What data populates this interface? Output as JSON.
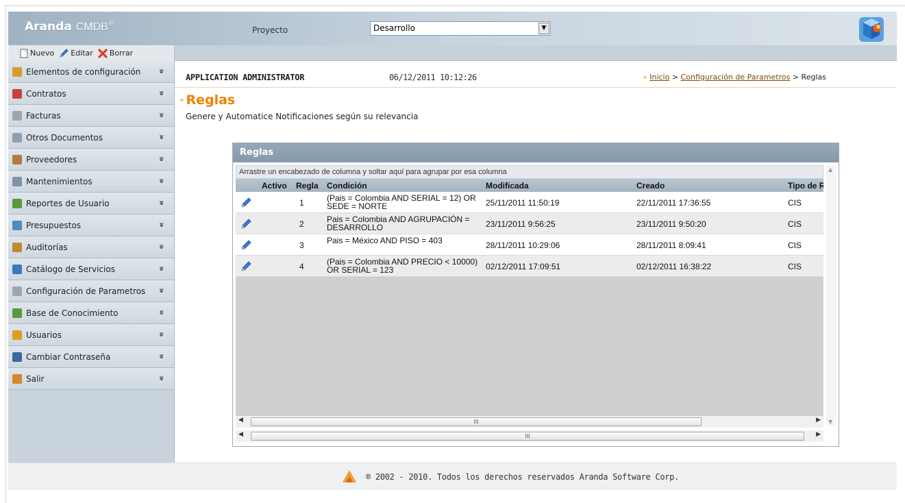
{
  "header": {
    "logo_brand": "Aranda",
    "logo_product": "CMDB",
    "logo_reg": "®",
    "project_label": "Proyecto",
    "project_value": "Desarrollo"
  },
  "toolbar": {
    "new_label": "Nuevo",
    "edit_label": "Editar",
    "delete_label": "Borrar"
  },
  "sidebar": {
    "items": [
      {
        "label": "Elementos de configuración",
        "icon": "gear-icon",
        "color": "#d89b2a"
      },
      {
        "label": "Contratos",
        "icon": "contract-icon",
        "color": "#c84040"
      },
      {
        "label": "Facturas",
        "icon": "invoice-icon",
        "color": "#9aa7b3"
      },
      {
        "label": "Otros Documentos",
        "icon": "documents-icon",
        "color": "#8fa0b0"
      },
      {
        "label": "Proveedores",
        "icon": "provider-icon",
        "color": "#b07a40"
      },
      {
        "label": "Mantenimientos",
        "icon": "maintenance-icon",
        "color": "#7f93a6"
      },
      {
        "label": "Reportes de Usuario",
        "icon": "report-icon",
        "color": "#5a9a3a"
      },
      {
        "label": "Presupuestos",
        "icon": "budget-icon",
        "color": "#4f8ac0"
      },
      {
        "label": "Auditorías",
        "icon": "audit-icon",
        "color": "#c08a30"
      },
      {
        "label": "Catálogo de Servicios",
        "icon": "catalog-icon",
        "color": "#3a7ac0"
      },
      {
        "label": "Configuración de Parametros",
        "icon": "settings-icon",
        "color": "#9aa7b3"
      },
      {
        "label": "Base de Conocimiento",
        "icon": "knowledge-icon",
        "color": "#5a9a3a"
      },
      {
        "label": "Usuarios",
        "icon": "users-icon",
        "color": "#d8a020"
      },
      {
        "label": "Cambiar Contraseña",
        "icon": "password-icon",
        "color": "#3a6aa0"
      },
      {
        "label": "Salir",
        "icon": "exit-icon",
        "color": "#d08a30"
      }
    ],
    "chevron": "»"
  },
  "info": {
    "user": "APPLICATION ADMINISTRATOR",
    "datetime": "06/12/2011 10:12:26",
    "breadcrumb_arrow": "»",
    "crumb_home": "Inicio",
    "crumb_sep": ">",
    "crumb_config": "Configuración de Parametros",
    "crumb_current": "Reglas"
  },
  "page": {
    "title_marker": "»",
    "title": "Reglas",
    "subtitle": "Genere y Automatice Notificaciones según su relevancia"
  },
  "grid": {
    "panel_title": "Reglas",
    "group_hint": "Arrastre un encabezado de columna y soltar aquí para agrupar por esa columna",
    "columns": [
      "Activo",
      "Regla",
      "Condición",
      "Modificada",
      "Creado",
      "Tipo de R"
    ],
    "rows": [
      {
        "regla": "1",
        "condicion": "(Pais = Colombia AND SERIAL = 12) OR SEDE = NORTE",
        "modificada": "25/11/2011 11:50:19",
        "creado": "22/11/2011 17:36:55",
        "tipo": "CIS"
      },
      {
        "regla": "2",
        "condicion": "Pais = Colombia AND AGRUPACIÓN = DESARROLLO",
        "modificada": "23/11/2011 9:56:25",
        "creado": "23/11/2011 9:50:20",
        "tipo": "CIS"
      },
      {
        "regla": "3",
        "condicion": "Pais = México AND PISO = 403",
        "modificada": "28/11/2011 10:29:06",
        "creado": "28/11/2011 8:09:41",
        "tipo": "CIS"
      },
      {
        "regla": "4",
        "condicion": "(Pais = Colombia AND PRECIO < 10000) OR SERIAL = 123",
        "modificada": "02/12/2011 17:09:51",
        "creado": "02/12/2011 16:38:22",
        "tipo": "CIS"
      }
    ],
    "scroll_thumb_label": "III"
  },
  "footer": {
    "text": "® 2002 - 2010. Todos los derechos reservados Aranda Software Corp."
  },
  "colors": {
    "accent_orange": "#f08000",
    "header_blue": "#9fb2c3",
    "sidebar_bg": "#c9d3db"
  }
}
